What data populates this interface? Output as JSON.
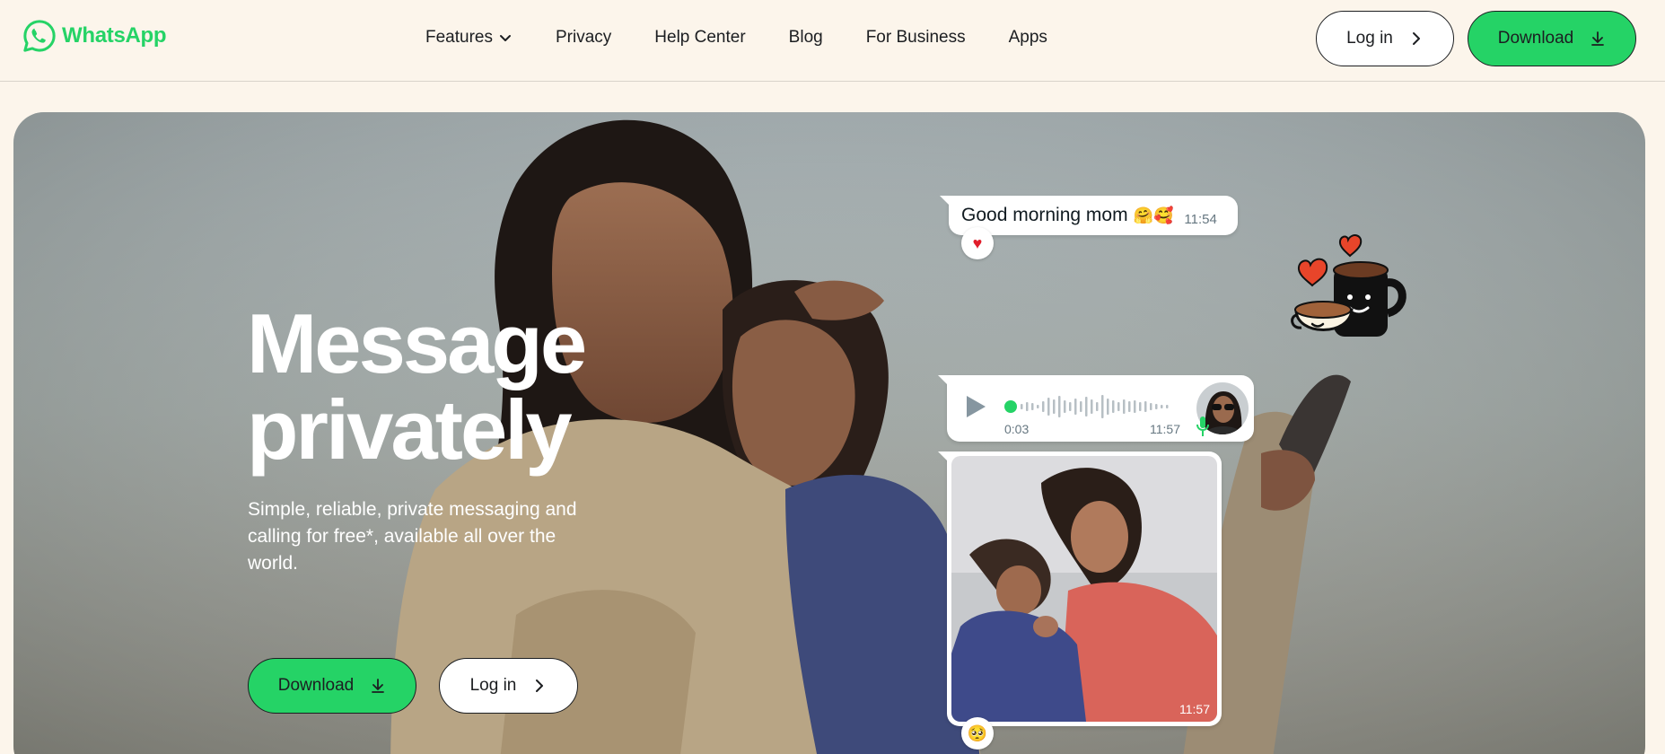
{
  "header": {
    "logo_text": "WhatsApp",
    "nav": [
      {
        "label": "Features",
        "has_dropdown": true
      },
      {
        "label": "Privacy"
      },
      {
        "label": "Help Center"
      },
      {
        "label": "Blog"
      },
      {
        "label": "For Business"
      },
      {
        "label": "Apps"
      }
    ],
    "login_label": "Log in",
    "download_label": "Download"
  },
  "hero": {
    "title_line1": "Message",
    "title_line2": "privately",
    "subtitle": "Simple, reliable, private messaging and calling for free*, available all over the world.",
    "download_label": "Download",
    "login_label": "Log in"
  },
  "chat": {
    "text_message": "Good morning mom",
    "text_emojis": "🤗🥰",
    "text_time": "11:54",
    "text_reaction": "♥",
    "voice_duration": "0:03",
    "voice_time": "11:57",
    "photo_time": "11:57",
    "photo_reaction": "🥺"
  },
  "icons": {
    "logo": "whatsapp-logo-icon",
    "dropdown": "chevron-down-icon",
    "arrow": "chevron-right-icon",
    "download": "download-icon",
    "play": "play-icon",
    "mic": "microphone-icon",
    "sticker": "coffee-cups-hearts-sticker"
  },
  "colors": {
    "brand_green": "#25D366",
    "page_bg": "#FCF5EB",
    "text_dark": "#1C1E21"
  }
}
